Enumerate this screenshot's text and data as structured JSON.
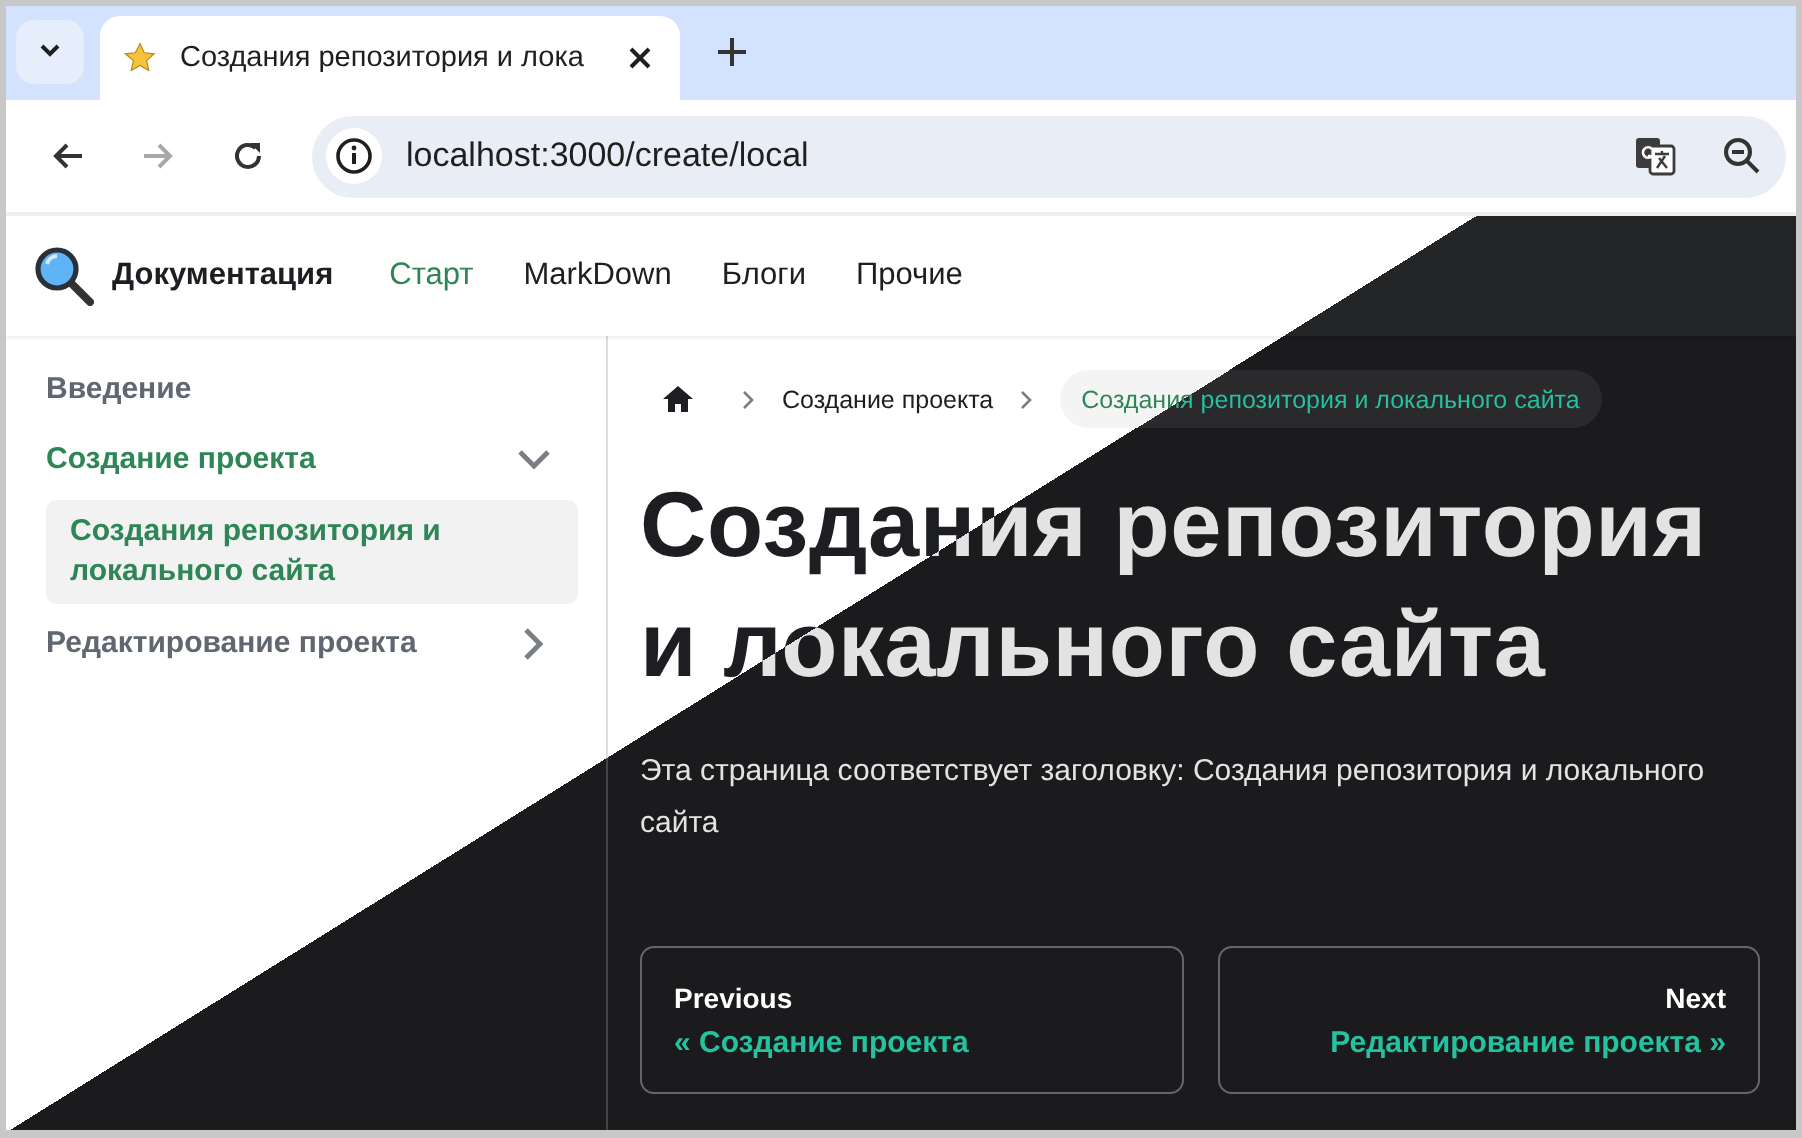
{
  "browser": {
    "tab": {
      "title": "Создания репозитория и лока",
      "selected": true
    },
    "toolbar": [
      {
        "kind": "back",
        "disabled": false
      },
      {
        "kind": "forward",
        "disabled": true
      },
      {
        "kind": "reload",
        "disabled": false
      }
    ],
    "address": {
      "url": "localhost:3000/create/local"
    }
  },
  "site": {
    "brand": "Документация",
    "nav": [
      {
        "label": "Старт",
        "selected": true
      },
      {
        "label": "MarkDown",
        "selected": false
      },
      {
        "label": "Блоги",
        "selected": false
      },
      {
        "label": "Прочие",
        "selected": false
      }
    ]
  },
  "sidebar": {
    "items": [
      {
        "label": "Введение",
        "kind": "link",
        "selected": false
      },
      {
        "label": "Создание проекта",
        "kind": "category",
        "expanded": true,
        "selected": false,
        "children": [
          {
            "label": "Создания репозитория и локального сайта",
            "selected": true
          }
        ]
      },
      {
        "label": "Редактирование проекта",
        "kind": "category",
        "expanded": false,
        "selected": false
      }
    ]
  },
  "breadcrumbs": [
    {
      "kind": "home"
    },
    {
      "kind": "link",
      "label": "Создание проекта",
      "selected": false
    },
    {
      "kind": "link",
      "label": "Создания репозитория и локального сайта",
      "selected": true
    }
  ],
  "title": "Создания репозитория и локального сайта",
  "paragraph": "Эта страница соответствует заголовку: Создания репозитория и локального сайта",
  "pagination": [
    {
      "kind": "previous",
      "sublabel": "Previous",
      "label": "« Создание проекта"
    },
    {
      "kind": "next",
      "sublabel": "Next",
      "label": "Редактирование проекта »"
    }
  ]
}
